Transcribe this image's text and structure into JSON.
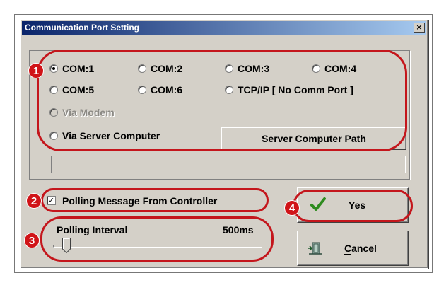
{
  "window": {
    "title": "Communication Port Setting",
    "close_label": "×"
  },
  "ports": [
    {
      "label": "COM:1",
      "selected": true
    },
    {
      "label": "COM:2",
      "selected": false
    },
    {
      "label": "COM:3",
      "selected": false
    },
    {
      "label": "COM:4",
      "selected": false
    },
    {
      "label": "COM:5",
      "selected": false
    },
    {
      "label": "COM:6",
      "selected": false
    },
    {
      "label": "TCP/IP [ No Comm Port ]",
      "selected": false
    }
  ],
  "via_modem": {
    "label": "Via Modem",
    "enabled": false
  },
  "via_server": {
    "label": "Via Server Computer"
  },
  "server_path_button": "Server Computer Path",
  "server_path_value": "",
  "polling_message": {
    "label": "Polling Message From Controller",
    "checked": true,
    "check_glyph": "✓"
  },
  "polling_interval": {
    "label": "Polling Interval",
    "value": "500ms"
  },
  "buttons": {
    "yes": {
      "label": "Yes",
      "icon": "checkmark-icon"
    },
    "cancel": {
      "label": "Cancel",
      "icon": "door-exit-icon"
    }
  },
  "callouts": [
    "1",
    "2",
    "3",
    "4"
  ],
  "colors": {
    "callout_red": "#c4161c",
    "dialog_face": "#d4d0c8",
    "title_blue": "#0a246a",
    "check_green": "#2e8b1f"
  }
}
